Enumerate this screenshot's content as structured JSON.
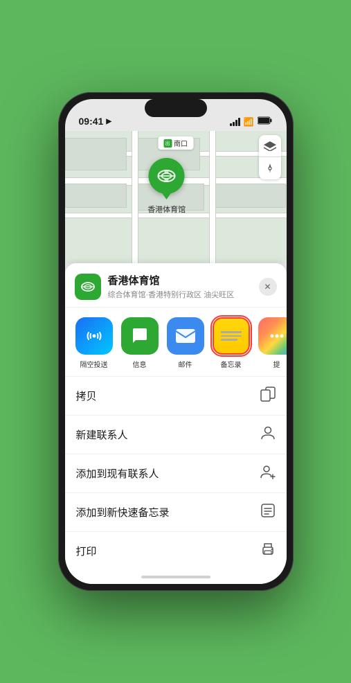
{
  "status_bar": {
    "time": "09:41",
    "location_arrow": "▶"
  },
  "map": {
    "location_label": "南口",
    "pin_label": "香港体育馆",
    "controls": {
      "map_icon": "🗺",
      "location_icon": "➤"
    }
  },
  "sheet": {
    "venue_name": "香港体育馆",
    "venue_subtitle": "综合体育馆·香港特别行政区 油尖旺区",
    "close_label": "✕"
  },
  "share_items": [
    {
      "id": "airdrop",
      "label": "隔空投送",
      "type": "airdrop"
    },
    {
      "id": "message",
      "label": "信息",
      "type": "message"
    },
    {
      "id": "mail",
      "label": "邮件",
      "type": "mail"
    },
    {
      "id": "notes",
      "label": "备忘录",
      "type": "notes"
    },
    {
      "id": "more",
      "label": "提",
      "type": "more"
    }
  ],
  "actions": [
    {
      "id": "copy",
      "label": "拷贝",
      "icon": "copy"
    },
    {
      "id": "new-contact",
      "label": "新建联系人",
      "icon": "person"
    },
    {
      "id": "add-contact",
      "label": "添加到现有联系人",
      "icon": "person-add"
    },
    {
      "id": "quick-notes",
      "label": "添加到新快速备忘录",
      "icon": "quick-note"
    },
    {
      "id": "print",
      "label": "打印",
      "icon": "printer"
    }
  ]
}
